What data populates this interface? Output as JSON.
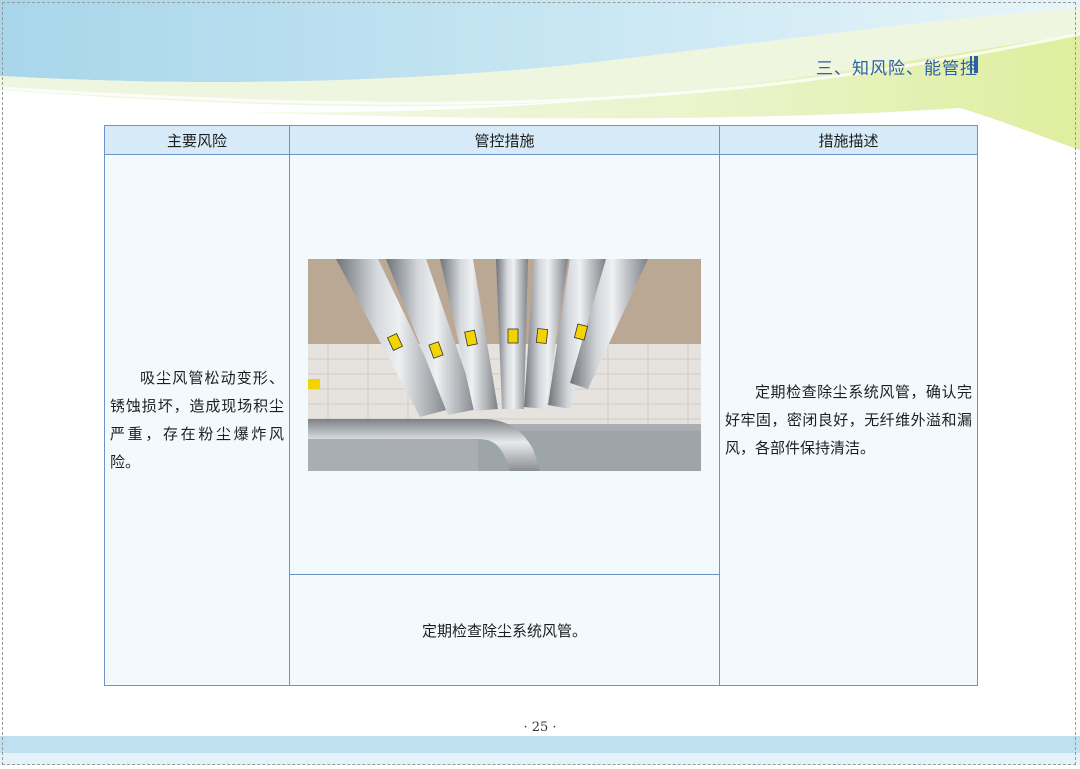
{
  "header": {
    "section_title": "三、知风险、能管控"
  },
  "table": {
    "headers": {
      "risk": "主要风险",
      "control": "管控措施",
      "description": "措施描述"
    },
    "risk_text": "吸尘风管松动变形、锈蚀损坏，造成现场积尘严重，存在粉尘爆炸风险。",
    "control_text": "定期检查除尘系统风管。",
    "description_text": "定期检查除尘系统风管，确认完好牢固，密闭良好，无纤维外溢和漏风，各部件保持清洁。"
  },
  "footer": {
    "page_number": "· 25 ·"
  },
  "colors": {
    "accent": "#2b5fa6",
    "header_bg": "#d6eaf8",
    "cell_bg": "#f2fafe",
    "border": "#6e93c9"
  }
}
